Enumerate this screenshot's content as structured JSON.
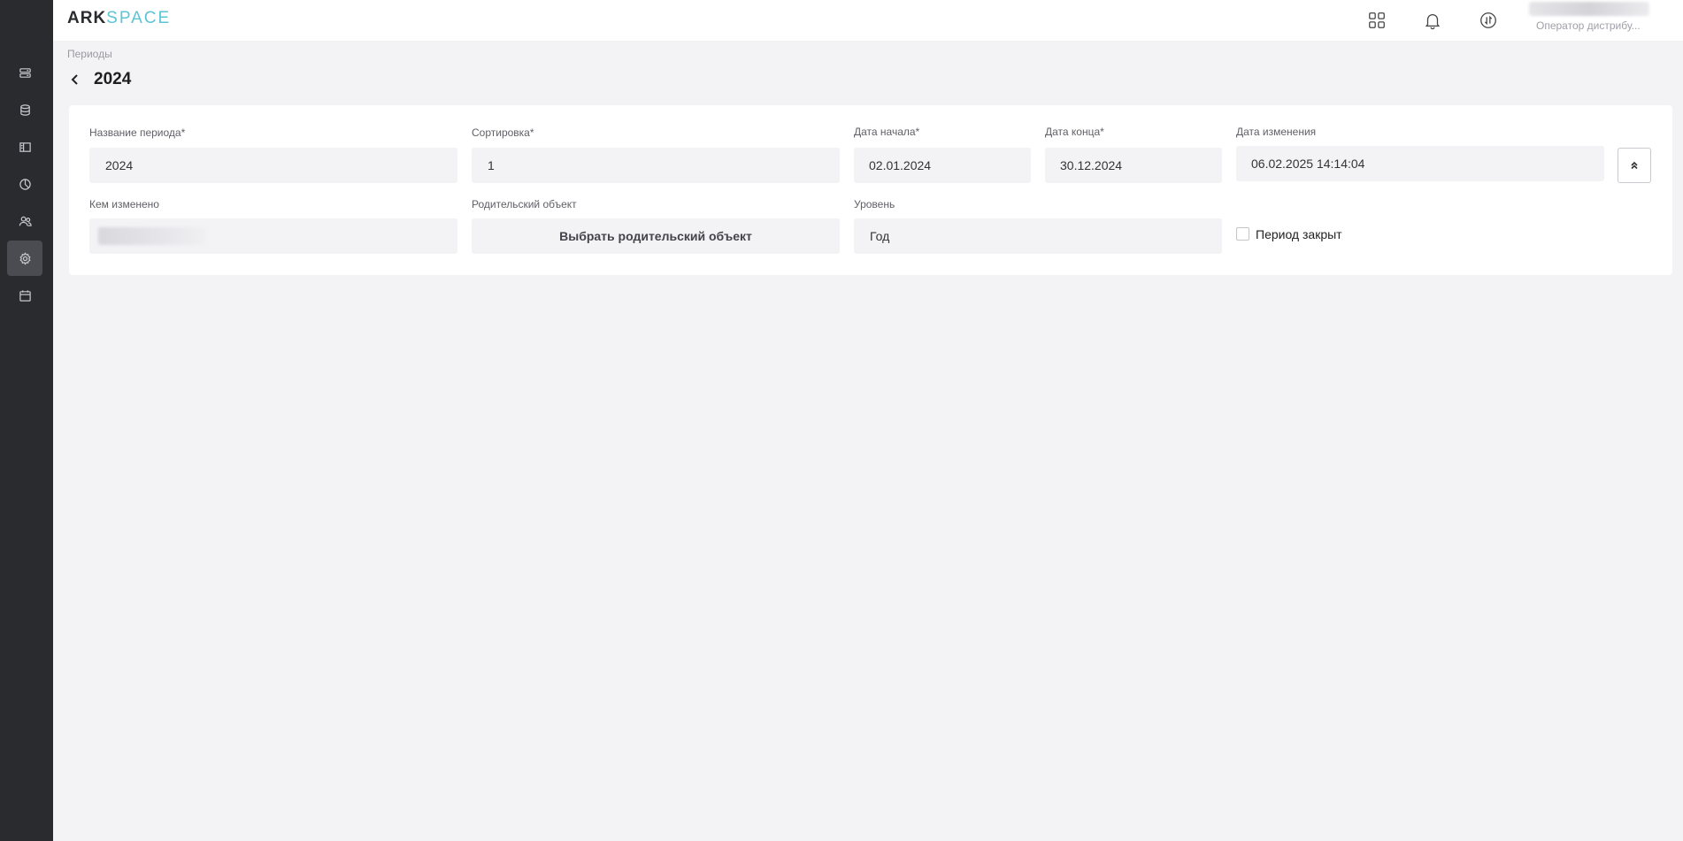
{
  "app": {
    "logo_left": "ARK",
    "logo_right": "SPACE",
    "logo_accent_color": "#5dc4d4"
  },
  "sidebar": {
    "items": [
      {
        "icon": "list-icon",
        "active": false
      },
      {
        "icon": "database-icon",
        "active": false
      },
      {
        "icon": "layout-icon",
        "active": false
      },
      {
        "icon": "pie-chart-icon",
        "active": false
      },
      {
        "icon": "users-icon",
        "active": false
      },
      {
        "icon": "gear-icon",
        "active": true
      },
      {
        "icon": "calendar-icon",
        "active": false
      }
    ]
  },
  "topbar": {
    "icons": [
      "apps-grid-icon",
      "bell-icon",
      "sync-icon"
    ],
    "user_role": "Оператор дистрибу..."
  },
  "breadcrumb": "Периоды",
  "page_title": "2024",
  "form": {
    "period_name": {
      "label": "Название периода*",
      "value": "2024"
    },
    "sorting": {
      "label": "Сортировка*",
      "value": "1"
    },
    "date_start": {
      "label": "Дата начала*",
      "value": "02.01.2024"
    },
    "date_end": {
      "label": "Дата конца*",
      "value": "30.12.2024"
    },
    "date_modified": {
      "label": "Дата изменения",
      "value": "06.02.2025 14:14:04"
    },
    "modified_by": {
      "label": "Кем изменено"
    },
    "parent_object": {
      "label": "Родительский объект",
      "button_label": "Выбрать родительский объект"
    },
    "level": {
      "label": "Уровень",
      "value": "Год"
    },
    "period_closed": {
      "label": "Период закрыт",
      "checked": false
    }
  }
}
